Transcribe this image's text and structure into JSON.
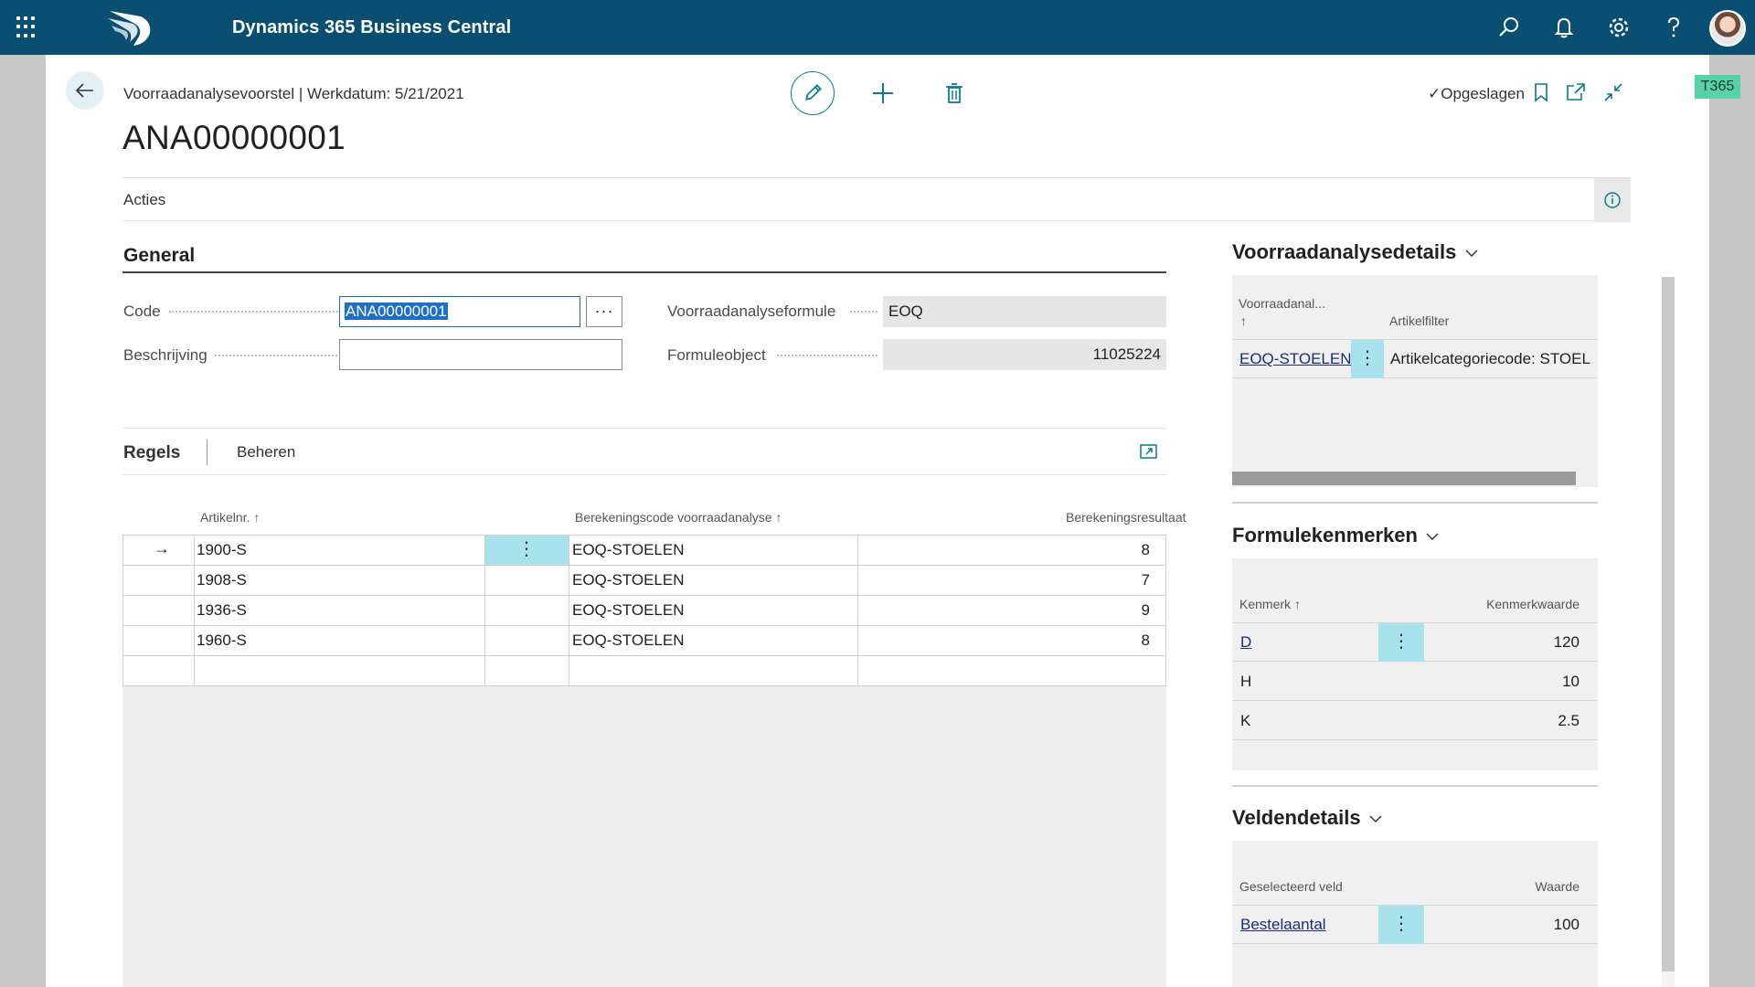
{
  "app": {
    "title": "Dynamics 365 Business Central",
    "badge": "T365"
  },
  "header": {
    "breadcrumb": "Voorraadanalysevoorstel | Werkdatum: 5/21/2021",
    "record_title": "ANA00000001",
    "status": "✓Opgeslagen"
  },
  "actions": {
    "label": "Acties"
  },
  "general": {
    "title": "General",
    "code_label": "Code",
    "code_value": "ANA00000001",
    "desc_label": "Beschrijving",
    "desc_value": "",
    "formula_label": "Voorraadanalyseformule",
    "formula_value": "EOQ",
    "object_label": "Formuleobject",
    "object_value": "11025224",
    "ellipsis": "···"
  },
  "lines": {
    "tab_label": "Regels",
    "manage_label": "Beheren",
    "columns": [
      "Artikelnr. ↑",
      "Berekeningscode voorraadanalyse ↑",
      "Berekeningsresultaat"
    ],
    "rows": [
      {
        "item": "1900-S",
        "code": "EOQ-STOELEN",
        "result": "8"
      },
      {
        "item": "1908-S",
        "code": "EOQ-STOELEN",
        "result": "7"
      },
      {
        "item": "1936-S",
        "code": "EOQ-STOELEN",
        "result": "9"
      },
      {
        "item": "1960-S",
        "code": "EOQ-STOELEN",
        "result": "8"
      }
    ],
    "row_marker": "→",
    "row_menu": "⋮"
  },
  "factbox": {
    "details": {
      "title": "Voorraadanalysedetails",
      "col1": "Voorraadanal...",
      "col1_sort": "↑",
      "col2": "Artikelfilter",
      "row": {
        "code": "EOQ-STOELEN",
        "filter": "Artikelcategoriecode: STOEL"
      }
    },
    "formula": {
      "title": "Formulekenmerken",
      "col1": "Kenmerk ↑",
      "col2": "Kenmerkwaarde",
      "rows": [
        {
          "key": "D",
          "value": "120"
        },
        {
          "key": "H",
          "value": "10"
        },
        {
          "key": "K",
          "value": "2.5"
        }
      ]
    },
    "fields": {
      "title": "Veldendetails",
      "col1": "Geselecteerd veld",
      "col2": "Waarde",
      "row": {
        "field": "Bestelaantal",
        "value": "100"
      }
    }
  },
  "colors": {
    "topbar": "#0a4f72",
    "accent": "#0a7a8c",
    "row_highlight": "#a8e2ed",
    "badge": "#58d1a6"
  }
}
